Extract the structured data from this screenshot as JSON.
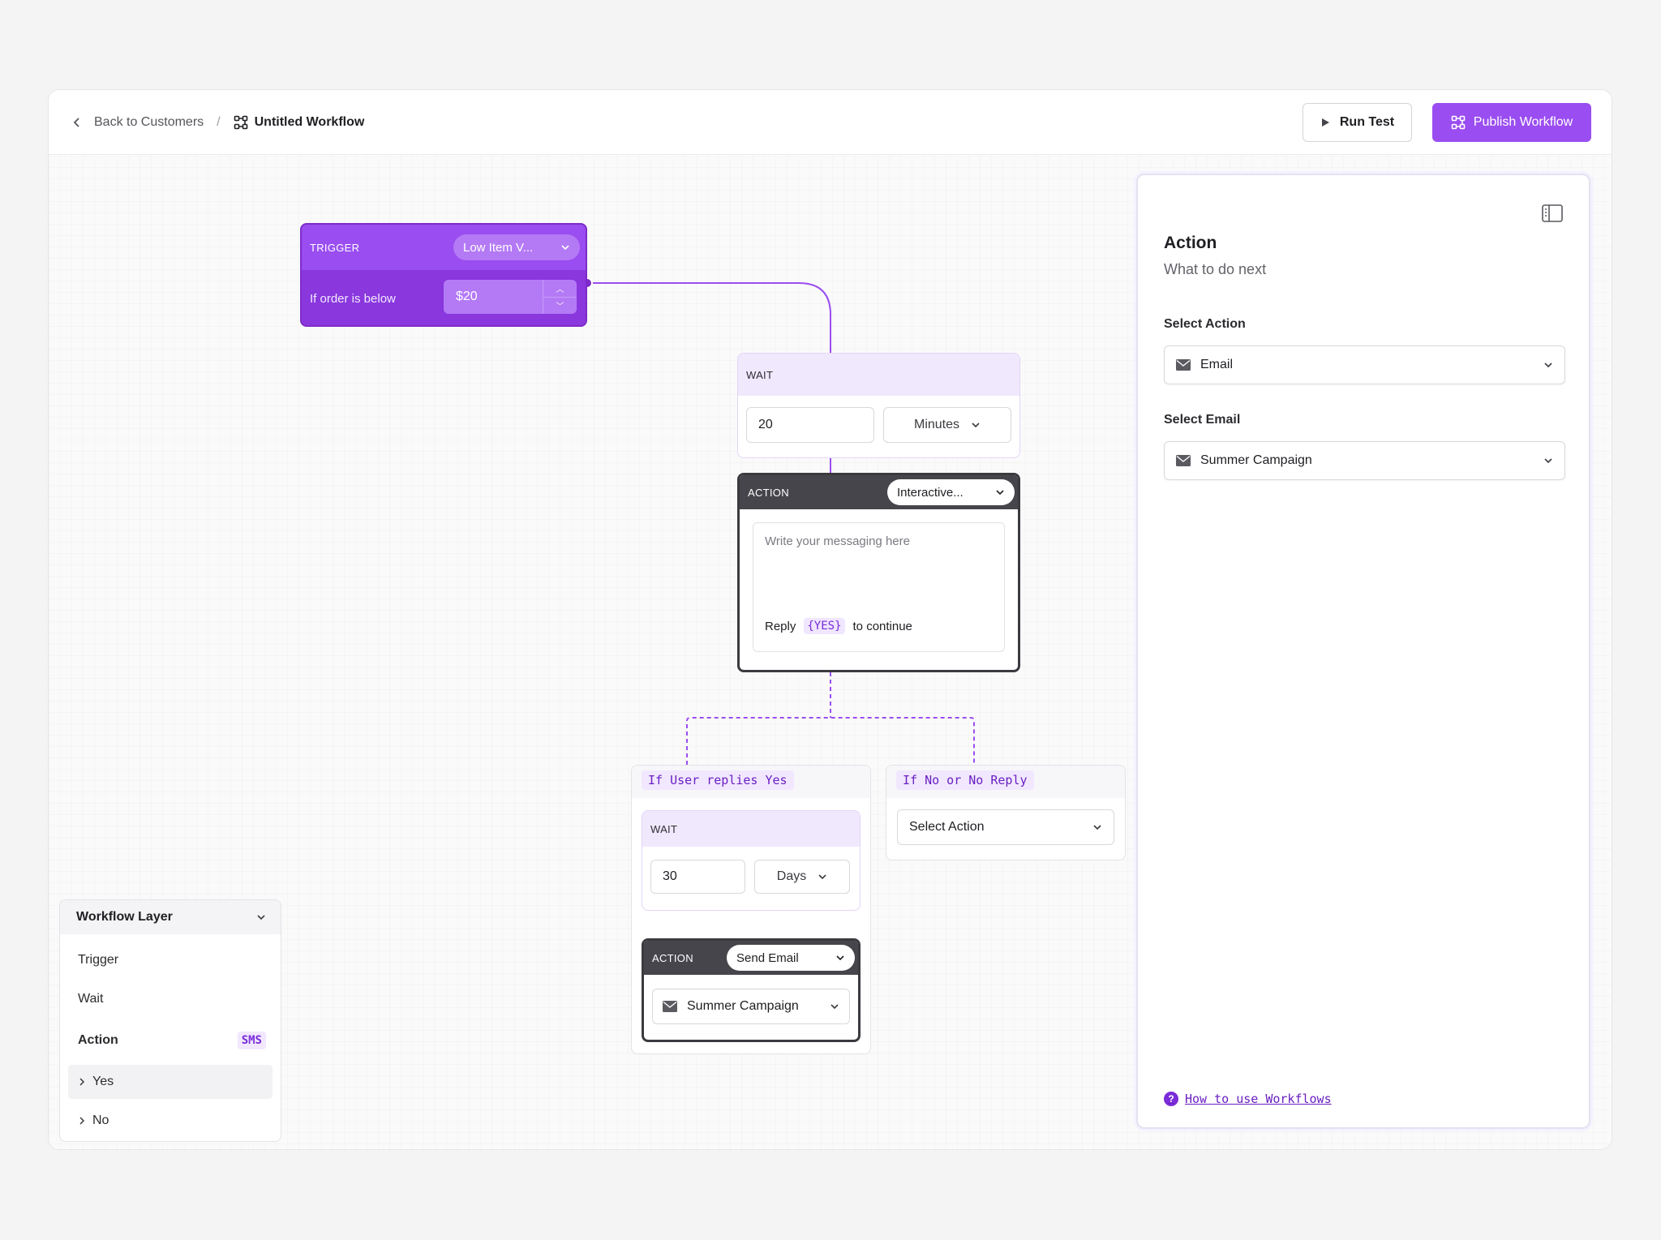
{
  "header": {
    "back_label": "Back to Customers",
    "separator": "/",
    "workflow_title": "Untitled Workflow",
    "run_test_label": "Run Test",
    "publish_label": "Publish Workflow"
  },
  "trigger": {
    "label": "TRIGGER",
    "event": "Low Item V...",
    "condition_label": "If order is below",
    "amount": "$20"
  },
  "wait1": {
    "label": "WAIT",
    "value": "20",
    "unit": "Minutes"
  },
  "action1": {
    "label": "ACTION",
    "type": "Interactive...",
    "placeholder": "Write your messaging here",
    "reply_prefix": "Reply",
    "reply_token": "{YES}",
    "reply_suffix": "to continue"
  },
  "branch_yes": {
    "title": "If User replies Yes",
    "wait": {
      "label": "WAIT",
      "value": "30",
      "unit": "Days"
    },
    "action": {
      "label": "ACTION",
      "type": "Send Email",
      "email": "Summer Campaign"
    }
  },
  "branch_no": {
    "title": "If No or No Reply",
    "select_placeholder": "Select Action"
  },
  "layers": {
    "title": "Workflow Layer",
    "items": [
      {
        "label": "Trigger"
      },
      {
        "label": "Wait"
      },
      {
        "label": "Action",
        "tag": "SMS"
      },
      {
        "label": "Yes"
      },
      {
        "label": "No"
      }
    ]
  },
  "panel": {
    "title": "Action",
    "subtitle": "What to do next",
    "select_action_label": "Select Action",
    "select_action_value": "Email",
    "select_email_label": "Select Email",
    "select_email_value": "Summer Campaign",
    "help_link": "How to use Workflows"
  },
  "colors": {
    "accent": "#9a4df0",
    "accent_dark": "#7e2cc9",
    "action_dark": "#45454b"
  }
}
